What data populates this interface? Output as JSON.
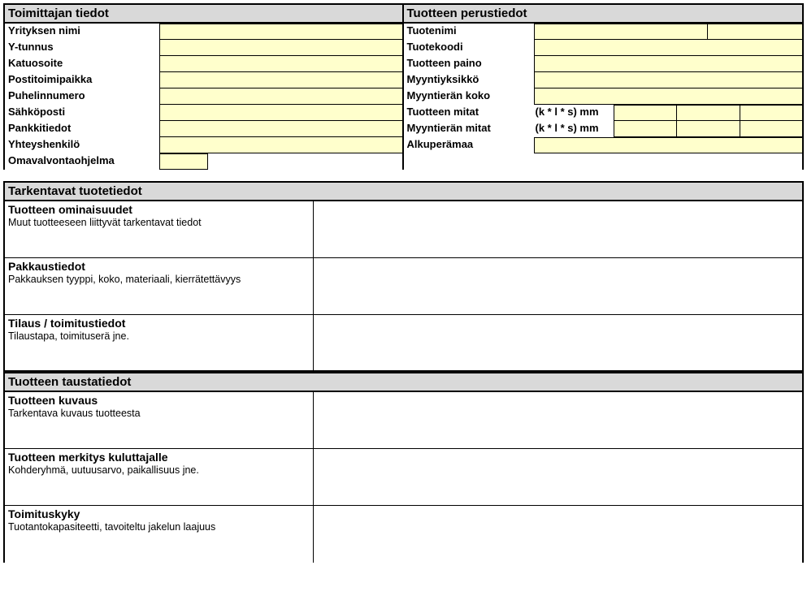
{
  "supplier": {
    "header": "Toimittajan tiedot",
    "fields": {
      "company": "Yrityksen nimi",
      "businessId": "Y-tunnus",
      "street": "Katuosoite",
      "city": "Postitoimipaikka",
      "phone": "Puhelinnumero",
      "email": "Sähköposti",
      "bank": "Pankkitiedot",
      "contact": "Yhteyshenkilö",
      "selfmonitor": "Omavalvontaohjelma"
    }
  },
  "product": {
    "header": "Tuotteen perustiedot",
    "fields": {
      "name": "Tuotenimi",
      "code": "Tuotekoodi",
      "weight": "Tuotteen paino",
      "unit": "Myyntiyksikkö",
      "batch": "Myyntierän koko",
      "dims": "Tuotteen mitat",
      "batchDims": "Myyntierän mitat",
      "origin": "Alkuperämaa",
      "dimHint": "(k * l * s) mm"
    }
  },
  "details": {
    "header": "Tarkentavat tuotetiedot",
    "rows": [
      {
        "title": "Tuotteen ominaisuudet",
        "sub": "Muut tuotteeseen liittyvät tarkentavat tiedot"
      },
      {
        "title": "Pakkaustiedot",
        "sub": "Pakkauksen tyyppi, koko, materiaali, kierrätettävyys"
      },
      {
        "title": "Tilaus / toimitustiedot",
        "sub": "Tilaustapa, toimituserä jne."
      }
    ]
  },
  "background": {
    "header": "Tuotteen taustatiedot",
    "rows": [
      {
        "title": "Tuotteen kuvaus",
        "sub": "Tarkentava kuvaus tuotteesta"
      },
      {
        "title": "Tuotteen merkitys kuluttajalle",
        "sub": "Kohderyhmä, uutuusarvo, paikallisuus jne."
      },
      {
        "title": "Toimituskyky",
        "sub": "Tuotantokapasiteetti, tavoiteltu jakelun laajuus"
      }
    ]
  }
}
